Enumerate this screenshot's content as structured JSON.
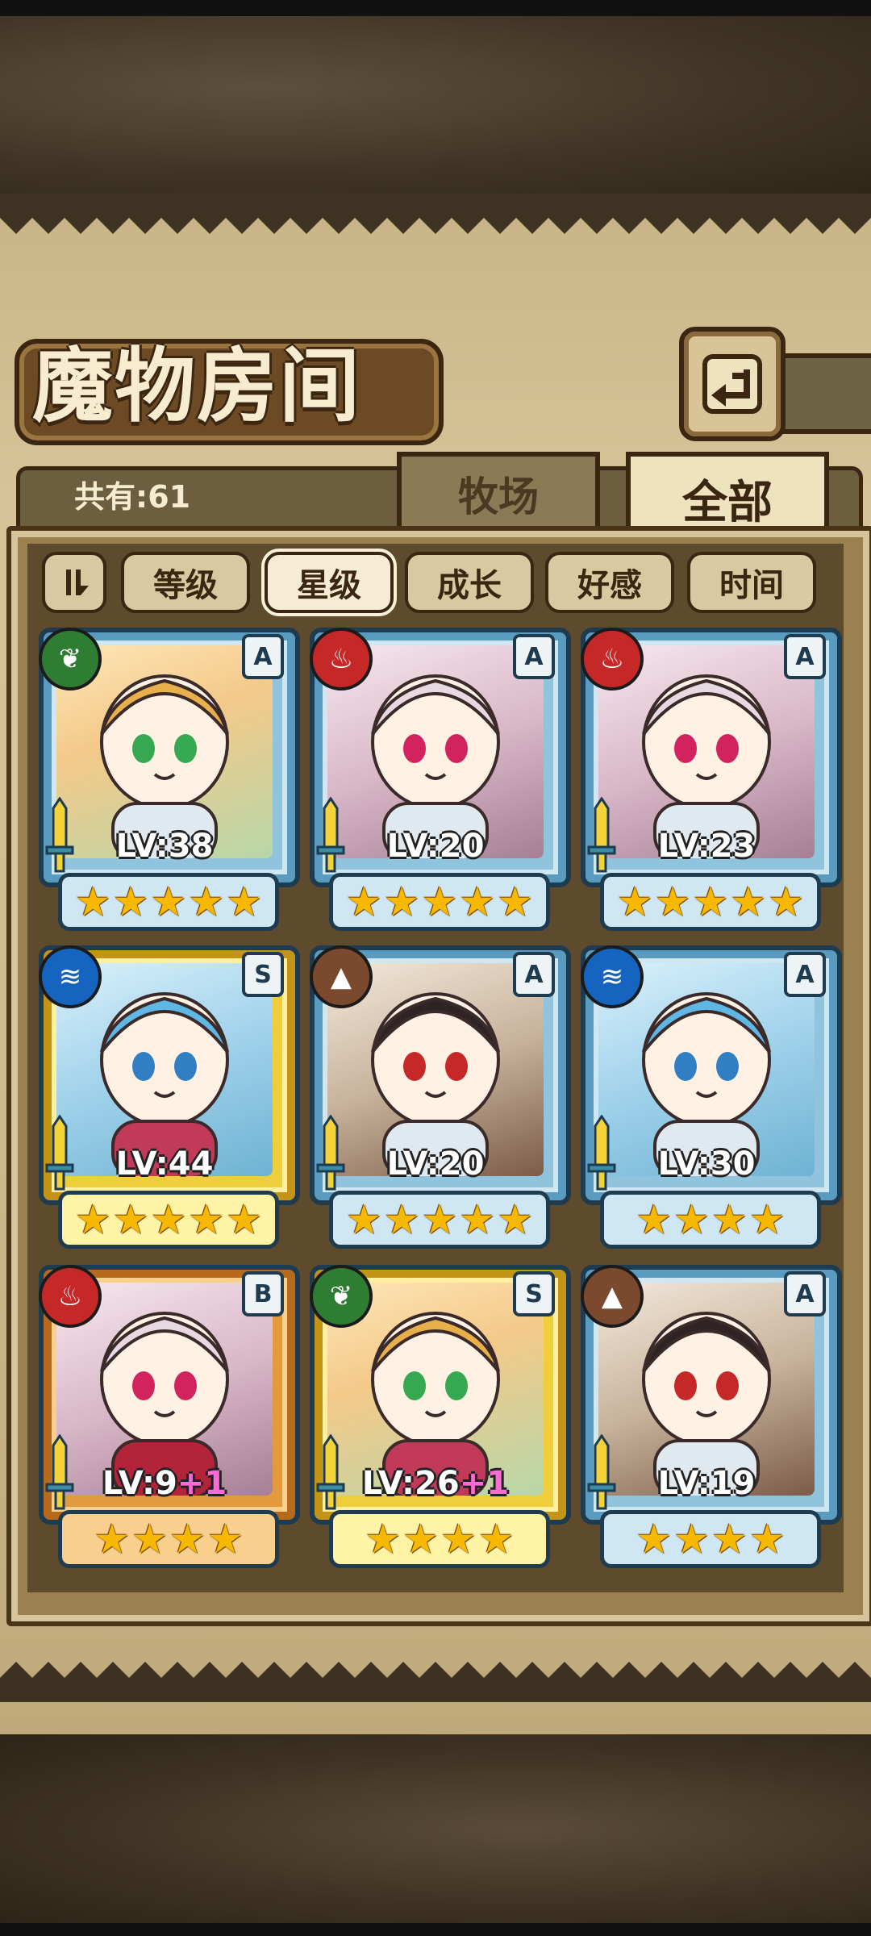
{
  "title": "魔物房间",
  "count_label": "共有:61",
  "tabs": {
    "ranch": "牧场",
    "all": "全部"
  },
  "sort": {
    "toggle_icon": "sort-toggle-icon",
    "buttons": [
      "等级",
      "星级",
      "成长",
      "好感",
      "时间"
    ],
    "active": "星级"
  },
  "icons": {
    "back": "back-arrow-icon",
    "weapon": "sword-icon"
  },
  "colors": {
    "parchment": "#d6c498",
    "panel": "#5e4a2c",
    "frame_blue": "#8fc4dc",
    "frame_gold": "#f0cd3a",
    "frame_orange": "#e39a3c",
    "star": "#f6b800",
    "level_bonus": "#ff6ad5"
  },
  "monsters": [
    {
      "element": "nature",
      "element_glyph": "❦",
      "rank": "A",
      "level": "LV:38",
      "bonus": "",
      "stars": 5,
      "frame": "blue"
    },
    {
      "element": "fire",
      "element_glyph": "♨",
      "rank": "A",
      "level": "LV:20",
      "bonus": "",
      "stars": 5,
      "frame": "blue"
    },
    {
      "element": "fire",
      "element_glyph": "♨",
      "rank": "A",
      "level": "LV:23",
      "bonus": "",
      "stars": 5,
      "frame": "blue"
    },
    {
      "element": "water",
      "element_glyph": "≋",
      "rank": "S",
      "level": "LV:44",
      "bonus": "",
      "stars": 5,
      "frame": "gold"
    },
    {
      "element": "earth",
      "element_glyph": "▲",
      "rank": "A",
      "level": "LV:20",
      "bonus": "",
      "stars": 5,
      "frame": "blue"
    },
    {
      "element": "water",
      "element_glyph": "≋",
      "rank": "A",
      "level": "LV:30",
      "bonus": "",
      "stars": 4,
      "frame": "blue"
    },
    {
      "element": "fire",
      "element_glyph": "♨",
      "rank": "B",
      "level": "LV:9",
      "bonus": "+1",
      "stars": 4,
      "frame": "orange"
    },
    {
      "element": "nature",
      "element_glyph": "❦",
      "rank": "S",
      "level": "LV:26",
      "bonus": "+1",
      "stars": 4,
      "frame": "gold"
    },
    {
      "element": "earth",
      "element_glyph": "▲",
      "rank": "A",
      "level": "LV:19",
      "bonus": "",
      "stars": 4,
      "frame": "blue"
    }
  ]
}
